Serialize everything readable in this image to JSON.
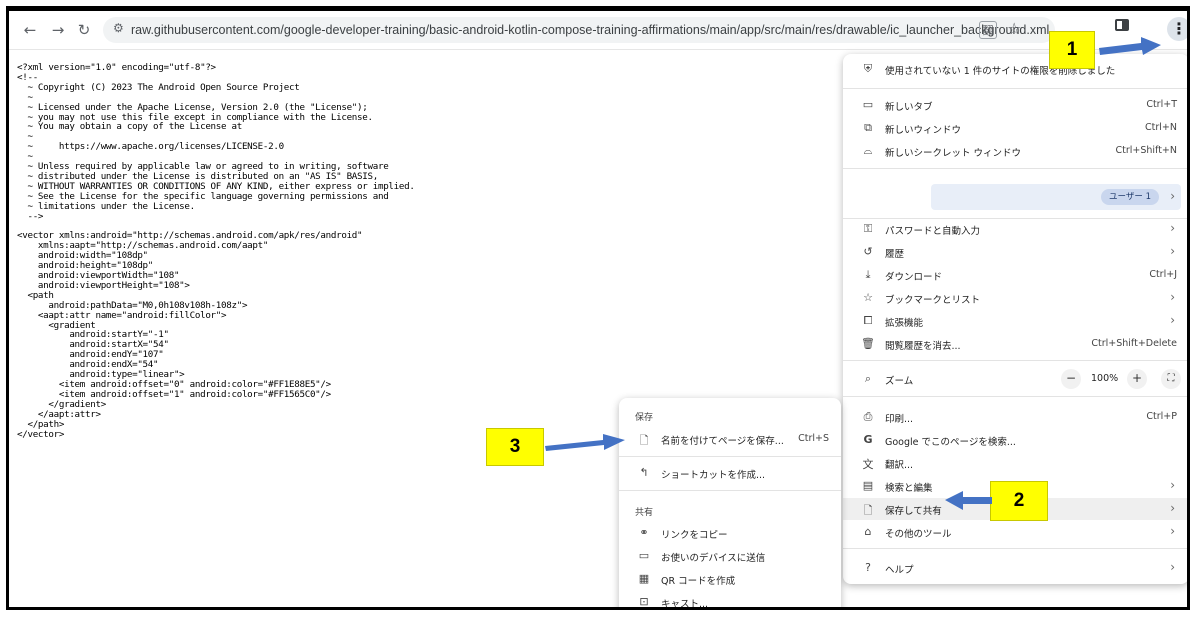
{
  "browser": {
    "url": "raw.githubusercontent.com/google-developer-training/basic-android-kotlin-compose-training-affirmations/main/app/src/main/res/drawable/ic_launcher_background.xml",
    "icons": {
      "back": "←",
      "forward": "→",
      "reload": "↻",
      "site_info": "⚙",
      "translate": "翻",
      "bookmark": "☆",
      "kebab": "⋮"
    }
  },
  "code_lines": [
    "<?xml version=\"1.0\" encoding=\"utf-8\"?>",
    "<!--",
    "  ~ Copyright (C) 2023 The Android Open Source Project",
    "  ~",
    "  ~ Licensed under the Apache License, Version 2.0 (the \"License\");",
    "  ~ you may not use this file except in compliance with the License.",
    "  ~ You may obtain a copy of the License at",
    "  ~",
    "  ~     https://www.apache.org/licenses/LICENSE-2.0",
    "  ~",
    "  ~ Unless required by applicable law or agreed to in writing, software",
    "  ~ distributed under the License is distributed on an \"AS IS\" BASIS,",
    "  ~ WITHOUT WARRANTIES OR CONDITIONS OF ANY KIND, either express or implied.",
    "  ~ See the License for the specific language governing permissions and",
    "  ~ limitations under the License.",
    "  -->",
    "",
    "<vector xmlns:android=\"http://schemas.android.com/apk/res/android\"",
    "    xmlns:aapt=\"http://schemas.android.com/aapt\"",
    "    android:width=\"108dp\"",
    "    android:height=\"108dp\"",
    "    android:viewportWidth=\"108\"",
    "    android:viewportHeight=\"108\">",
    "  <path",
    "      android:pathData=\"M0,0h108v108h-108z\">",
    "    <aapt:attr name=\"android:fillColor\">",
    "      <gradient",
    "          android:startY=\"-1\"",
    "          android:startX=\"54\"",
    "          android:endY=\"107\"",
    "          android:endX=\"54\"",
    "          android:type=\"linear\">",
    "        <item android:offset=\"0\" android:color=\"#FF1E88E5\"/>",
    "        <item android:offset=\"1\" android:color=\"#FF1565C0\"/>",
    "      </gradient>",
    "    </aapt:attr>",
    "  </path>",
    "</vector>"
  ],
  "main_menu": {
    "remove_permissions": "使用されていない 1 件のサイトの権限を削除しました",
    "new_tab": {
      "label": "新しいタブ",
      "shortcut": "Ctrl+T"
    },
    "new_window": {
      "label": "新しいウィンドウ",
      "shortcut": "Ctrl+N"
    },
    "incognito": {
      "label": "新しいシークレット ウィンドウ",
      "shortcut": "Ctrl+Shift+N"
    },
    "profile_chip": "ユーザー 1",
    "passwords": "パスワードと自動入力",
    "history": "履歴",
    "downloads": {
      "label": "ダウンロード",
      "shortcut": "Ctrl+J"
    },
    "bookmarks": "ブックマークとリスト",
    "extensions": "拡張機能",
    "clear_data": {
      "label": "閲覧履歴を消去...",
      "shortcut": "Ctrl+Shift+Delete"
    },
    "zoom": {
      "label": "ズーム",
      "minus": "−",
      "value": "100%",
      "plus": "+"
    },
    "print": {
      "label": "印刷...",
      "shortcut": "Ctrl+P"
    },
    "google_search": "Google でこのページを検索...",
    "translate": "翻訳...",
    "find_edit": "検索と編集",
    "save_share": "保存して共有",
    "more_tools": "その他のツール",
    "help": "ヘルプ"
  },
  "submenu": {
    "save_header": "保存",
    "save_page": {
      "label": "名前を付けてページを保存...",
      "shortcut": "Ctrl+S"
    },
    "create_shortcut": "ショートカットを作成...",
    "share_header": "共有",
    "copy_link": "リンクをコピー",
    "send_devices": "お使いのデバイスに送信",
    "qr_code": "QR コードを作成",
    "cast": "キャスト..."
  },
  "callouts": {
    "one": "1",
    "two": "2",
    "three": "3"
  },
  "colors": {
    "callout": "#ffff00",
    "arrow": "#4472c4",
    "highlight": "#efefef"
  }
}
